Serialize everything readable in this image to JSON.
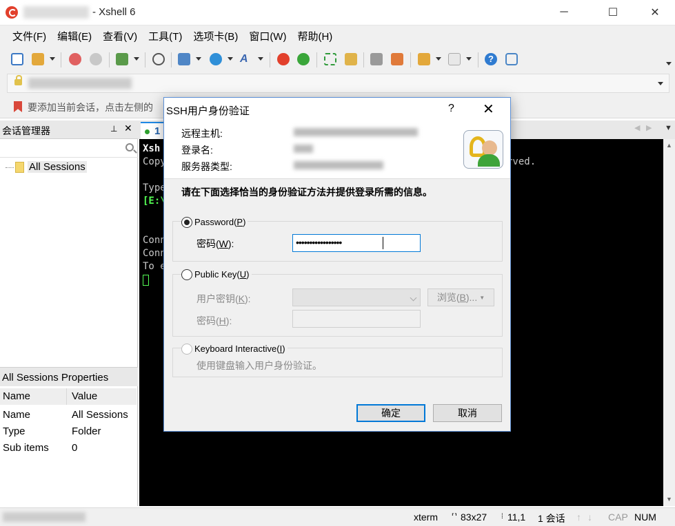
{
  "window": {
    "title": "- Xshell 6",
    "min": "─",
    "max": "☐",
    "close": "✕"
  },
  "menu": [
    "文件(F)",
    "编辑(E)",
    "查看(V)",
    "工具(T)",
    "选项卡(B)",
    "窗口(W)",
    "帮助(H)"
  ],
  "hint": {
    "text": "要添加当前会话，点击左侧的"
  },
  "session_manager": {
    "title": "会话管理器",
    "pin": "📌",
    "close": "✕",
    "tree": [
      {
        "label": "All Sessions"
      }
    ],
    "properties_title": "All Sessions Properties",
    "columns": [
      "Name",
      "Value"
    ],
    "rows": [
      {
        "name": "Name",
        "value": "All Sessions"
      },
      {
        "name": "Type",
        "value": "Folder"
      },
      {
        "name": "Sub items",
        "value": "0"
      }
    ]
  },
  "tab": {
    "number": "1"
  },
  "terminal": {
    "lines": [
      {
        "text": "Xsh",
        "color": "#ffffff",
        "bold": true
      },
      {
        "text": "Copy",
        "color": "#aaaaaa"
      },
      {
        "text": "",
        "color": "#aaaaaa"
      },
      {
        "text": "Type",
        "color": "#aaaaaa"
      },
      {
        "text": "[E:\\",
        "color": "#55ff55",
        "bold": true
      },
      {
        "text": "",
        "color": "#aaaaaa"
      },
      {
        "text": "",
        "color": "#aaaaaa"
      },
      {
        "text": "Conn",
        "color": "#aaaaaa"
      },
      {
        "text": "Conn",
        "color": "#aaaaaa"
      },
      {
        "text": "To e",
        "color": "#aaaaaa"
      }
    ],
    "right_text": "rved."
  },
  "status": {
    "term": "xterm",
    "size": "83x27",
    "pos": "11,1",
    "sessions": "1 会话",
    "cap": "CAP",
    "num": "NUM"
  },
  "dialog": {
    "title": "SSH用户身份验证",
    "help": "?",
    "close": "✕",
    "info_labels": [
      "远程主机:",
      "登录名:",
      "服务器类型:"
    ],
    "instruction": "请在下面选择恰当的身份验证方法并提供登录所需的信息。",
    "password": {
      "label": "Password",
      "accel": "P",
      "field_label": "密码",
      "field_accel": "W",
      "value": "•••••••••••••••••"
    },
    "public_key": {
      "label": "Public Key",
      "accel": "U",
      "key_label": "用户密钥",
      "key_accel": "K",
      "pass_label": "密码",
      "pass_accel": "H",
      "browse": "浏览",
      "browse_accel": "B"
    },
    "keyboard": {
      "label": "Keyboard Interactive",
      "accel": "I",
      "desc": "使用键盘输入用户身份验证。"
    },
    "ok": "确定",
    "cancel": "取消"
  }
}
